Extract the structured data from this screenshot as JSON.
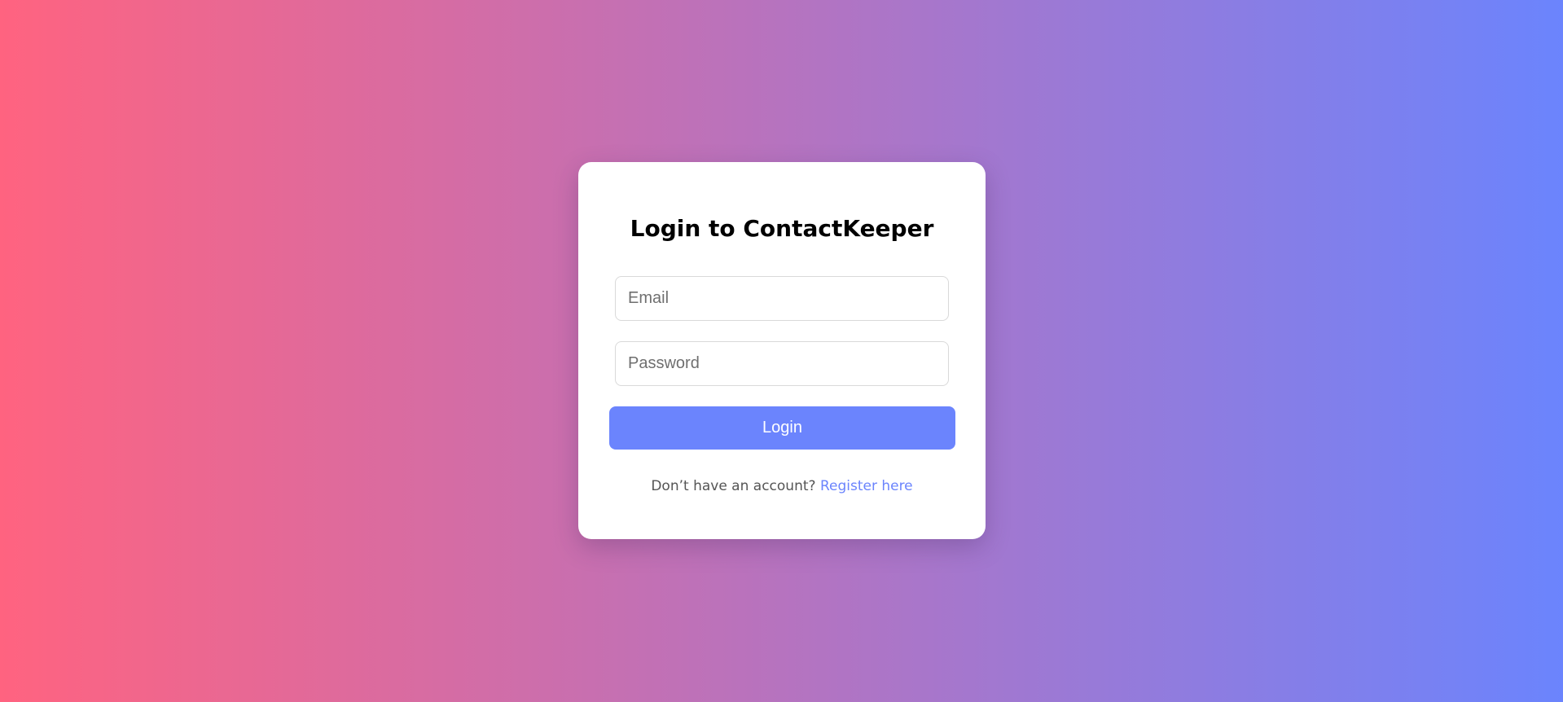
{
  "login_card": {
    "title": "Login to ContactKeeper",
    "email_field": {
      "placeholder": "Email",
      "value": ""
    },
    "password_field": {
      "placeholder": "Password",
      "value": ""
    },
    "login_button_label": "Login",
    "footer": {
      "prompt_text": "Don’t have an account?",
      "register_link_text": "Register here"
    }
  },
  "colors": {
    "background_gradient_start": "#ff6380",
    "background_gradient_end": "#6b84fd",
    "button_color": "#6b84fd",
    "link_color": "#6b84fd",
    "card_background": "#ffffff"
  }
}
